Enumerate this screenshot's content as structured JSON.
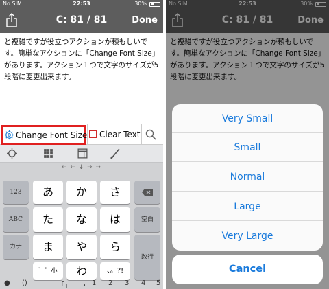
{
  "status": {
    "carrier": "No SIM",
    "time": "22:53",
    "battery": "30%"
  },
  "nav": {
    "title": "C: 81 / 81",
    "done": "Done"
  },
  "editor": {
    "lines": [
      "と複雑ですが役立つアクションが頼もしいで",
      "す。簡単なアクションに「Change Font Size」",
      "があります。アクション１つで文字のサイズが5",
      "段階に変更出来ます。"
    ]
  },
  "toolbar": {
    "change_font_size": "Change Font Size",
    "clear_text": "Clear Text",
    "highlight_color": "#e02020"
  },
  "keyboard": {
    "arrows": "← ← ↓ → →",
    "left_keys": [
      "123",
      "ABC",
      "カナ"
    ],
    "kana": [
      "あ",
      "か",
      "さ",
      "た",
      "な",
      "は",
      "ま",
      "や",
      "ら",
      "わ"
    ],
    "small_key": "゛゜小",
    "punct": "、。?!",
    "right_keys": [
      "空白",
      "改行"
    ],
    "bottom_row": [
      "()",
      "「」",
      "・",
      "1",
      "2",
      "3",
      "4",
      "5"
    ]
  },
  "sheet": {
    "options": [
      "Very Small",
      "Small",
      "Normal",
      "Large",
      "Very Large"
    ],
    "cancel": "Cancel",
    "accent_color": "#1b7bdc"
  }
}
